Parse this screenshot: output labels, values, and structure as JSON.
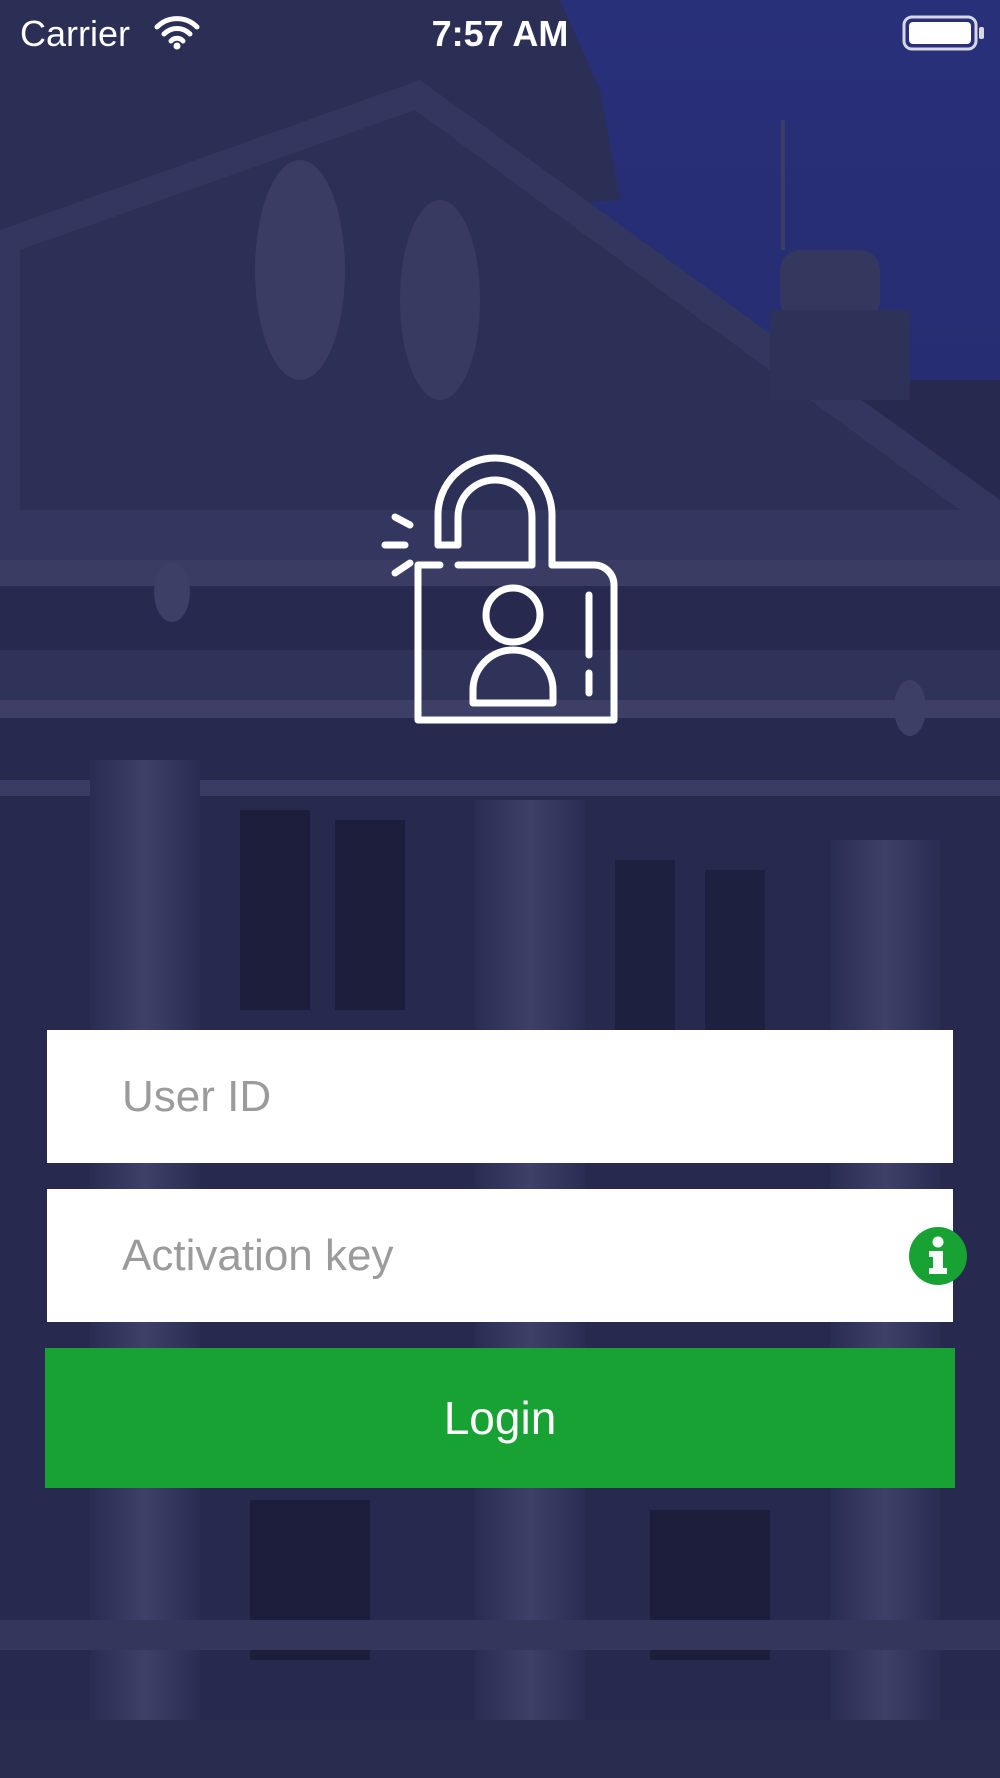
{
  "status_bar": {
    "carrier": "Carrier",
    "time": "7:57 AM",
    "wifi_icon": "wifi-icon",
    "battery_icon": "battery-full-icon"
  },
  "logo": {
    "icon": "unlock-user-icon"
  },
  "form": {
    "user_id_placeholder": "User ID",
    "activation_key_placeholder": "Activation key",
    "info_icon": "info-icon",
    "login_label": "Login"
  },
  "colors": {
    "overlay": "#1f2558",
    "login_button": "#18a234",
    "info_icon": "#18a234",
    "placeholder_text": "#9b9b9b",
    "field_background": "#ffffff"
  }
}
